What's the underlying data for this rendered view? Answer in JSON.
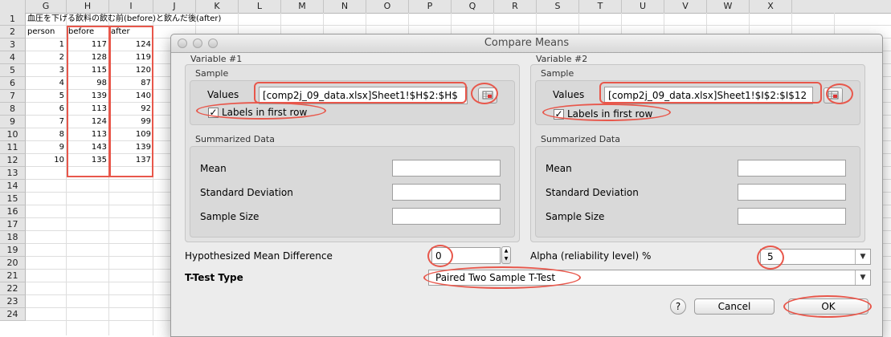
{
  "sheet": {
    "columns": [
      "G",
      "H",
      "I",
      "J",
      "K",
      "L",
      "M",
      "N",
      "O",
      "P",
      "Q",
      "R",
      "S",
      "T",
      "U",
      "V",
      "W",
      "X"
    ],
    "rows": [
      "1",
      "2",
      "3",
      "4",
      "5",
      "6",
      "7",
      "8",
      "9",
      "10",
      "11",
      "12",
      "13",
      "14",
      "15",
      "16",
      "17",
      "18",
      "19",
      "20",
      "21",
      "22",
      "23",
      "24"
    ],
    "title_cell": "血圧を下げる飲料の飲む前(before)と飲んだ後(after)",
    "headers": [
      "person",
      "before",
      "after"
    ],
    "data": [
      [
        "1",
        "117",
        "124"
      ],
      [
        "2",
        "128",
        "119"
      ],
      [
        "3",
        "115",
        "120"
      ],
      [
        "4",
        "98",
        "87"
      ],
      [
        "5",
        "139",
        "140"
      ],
      [
        "6",
        "113",
        "92"
      ],
      [
        "7",
        "124",
        "99"
      ],
      [
        "8",
        "113",
        "109"
      ],
      [
        "9",
        "143",
        "139"
      ],
      [
        "10",
        "135",
        "137"
      ]
    ]
  },
  "dialog": {
    "title": "Compare Means",
    "variable1": {
      "label": "Variable #1",
      "sample_label": "Sample",
      "values_label": "Values",
      "values": "[comp2j_09_data.xlsx]Sheet1!$H$2:$H$",
      "labels_first_row": "Labels in first row",
      "summarized_label": "Summarized Data",
      "mean_label": "Mean",
      "sd_label": "Standard Deviation",
      "size_label": "Sample Size"
    },
    "variable2": {
      "label": "Variable #2",
      "sample_label": "Sample",
      "values_label": "Values",
      "values": "[comp2j_09_data.xlsx]Sheet1!$I$2:$I$12",
      "labels_first_row": "Labels in first row",
      "summarized_label": "Summarized Data",
      "mean_label": "Mean",
      "sd_label": "Standard Deviation",
      "size_label": "Sample Size"
    },
    "hyp_label": "Hypothesized Mean Difference",
    "hyp_value": "0",
    "alpha_label": "Alpha (reliability level) %",
    "alpha_value": "5",
    "ttest_label": "T-Test Type",
    "ttest_value": "Paired Two Sample T-Test",
    "help_label": "?",
    "cancel_label": "Cancel",
    "ok_label": "OK",
    "checkmark": "✓",
    "stepper_up": "▲",
    "stepper_down": "▼",
    "dropdown_arrow": "▼"
  },
  "colors": {
    "highlight": "#e8574b"
  }
}
